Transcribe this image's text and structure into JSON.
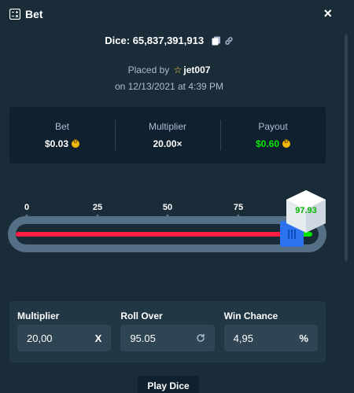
{
  "header": {
    "title": "Bet",
    "close": "×"
  },
  "dice_line": {
    "label": "Dice: 65,837,391,913"
  },
  "placed": {
    "prefix": "Placed by",
    "user": "jet007",
    "date": "on 12/13/2021 at 4:39 PM"
  },
  "summary": {
    "bet_label": "Bet",
    "bet_value": "$0.03",
    "multiplier_label": "Multiplier",
    "multiplier_value": "20.00×",
    "payout_label": "Payout",
    "payout_value": "$0.60"
  },
  "slider": {
    "ticks": [
      "0",
      "25",
      "50",
      "75"
    ],
    "roll_over_value": 95.05,
    "result": "97.93"
  },
  "form": {
    "multiplier_label": "Multiplier",
    "multiplier_value": "20,00",
    "multiplier_suffix": "X",
    "rollover_label": "Roll Over",
    "rollover_value": "95.05",
    "winchance_label": "Win Chance",
    "winchance_value": "4,95",
    "winchance_suffix": "%"
  },
  "play_button": "Play Dice",
  "colors": {
    "bg": "#1a2c38",
    "win": "#00e701",
    "lose": "#ff1f44",
    "handle": "#2c72ee",
    "coin": "#f2b90d"
  },
  "icons": [
    "bet-icon",
    "close-icon",
    "copy-icon",
    "link-icon",
    "star-icon",
    "coin-icon",
    "refresh-icon"
  ]
}
